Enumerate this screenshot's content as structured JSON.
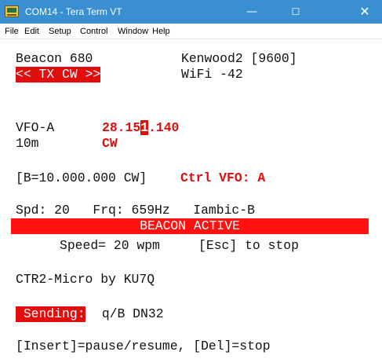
{
  "window": {
    "title": "COM14 - Tera Term VT",
    "icon": "teraterm-icon",
    "controls": {
      "minimize": "—",
      "maximize": "☐",
      "close": "✕"
    }
  },
  "menu": [
    "File",
    "Edit",
    "Setup",
    "Control",
    "Window",
    "Help"
  ],
  "terminal": {
    "beacon": "Beacon 680",
    "radio": "Kenwood2 [9600]",
    "tx_mode": "<< TX CW >>",
    "wifi": "WiFi -42",
    "vfo_label": "VFO-A",
    "freq_pre": "28.15",
    "freq_cursor": "1",
    "freq_post": ".140",
    "band": "10m",
    "mode": "CW",
    "vfo_b": "[B=10.000.000 CW]",
    "ctrl_vfo": "Ctrl VFO: A",
    "status_line": "Spd: 20   Frq: 659Hz   Iambic-B",
    "banner": "BEACON ACTIVE",
    "speed_line": "Speed= 20 wpm     [Esc] to stop",
    "credit": "CTR2-Micro by KU7Q",
    "sending_label": " Sending:",
    "sending_text": " q/B DN32",
    "help": "[Insert]=pause/resume, [Del]=stop"
  },
  "colors": {
    "titlebar": "#3a8fd1",
    "accent_red": "#e20d0d",
    "banner": "#ff1111"
  }
}
